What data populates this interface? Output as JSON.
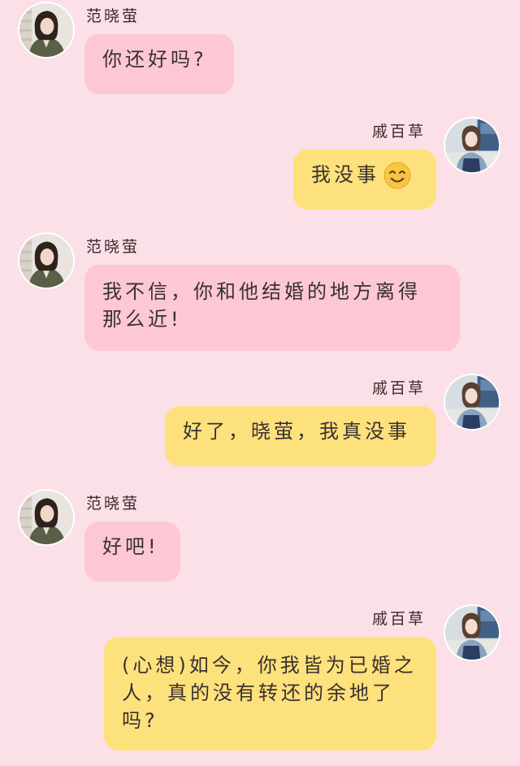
{
  "contacts": {
    "left_name": "范晓萤",
    "right_name": "戚百草"
  },
  "messages": [
    {
      "sender": "范晓萤",
      "side": "left",
      "text": "你还好吗?"
    },
    {
      "sender": "戚百草",
      "side": "right",
      "text": "我没事",
      "emoji": "smiling-face-icon"
    },
    {
      "sender": "范晓萤",
      "side": "left",
      "text": "我不信，你和他结婚的地方离得那么近!"
    },
    {
      "sender": "戚百草",
      "side": "right",
      "text": "好了，晓萤，我真没事"
    },
    {
      "sender": "范晓萤",
      "side": "left",
      "text": "好吧!"
    },
    {
      "sender": "戚百草",
      "side": "right",
      "text": "(心想)如今，你我皆为已婚之人，真的没有转还的余地了吗?"
    }
  ],
  "colors": {
    "background": "#fbe0e8",
    "left_bubble": "#fdc8d4",
    "right_bubble": "#fde17c"
  }
}
